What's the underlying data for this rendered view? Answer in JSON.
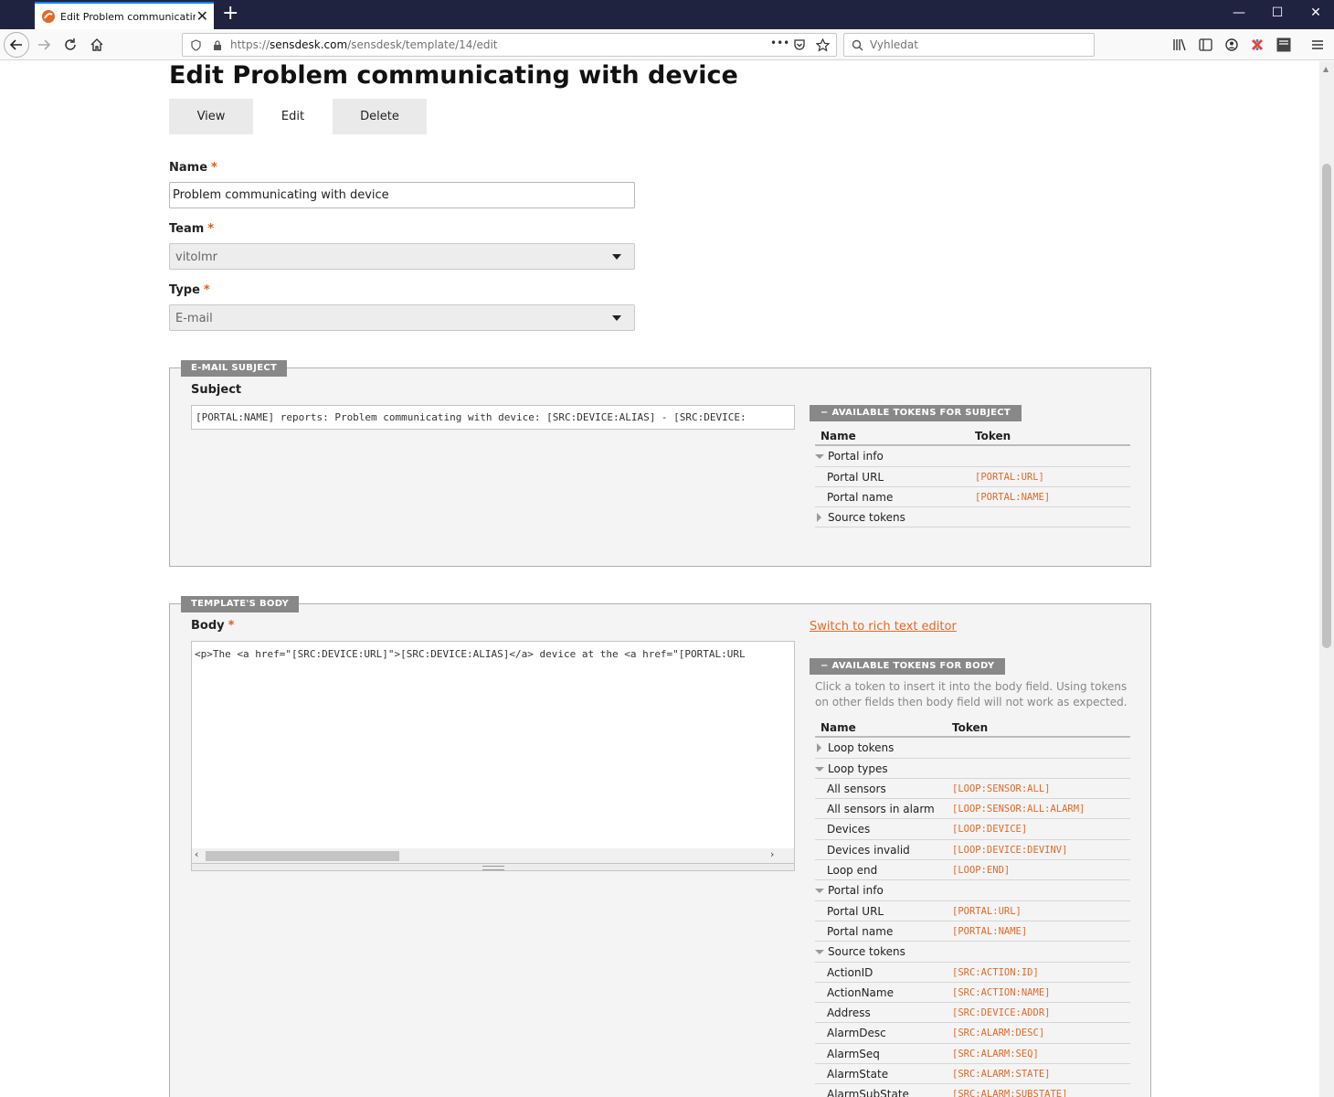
{
  "browser": {
    "tab_title": "Edit Problem communicating w",
    "tab_close": "✕",
    "new_tab": "+",
    "url_domain": "sensdesk.com",
    "url_prefix": "https://",
    "url_path": "/sensdesk/template/14/edit",
    "search_placeholder": "Vyhledat",
    "page_actions": "•••",
    "window_minimize": "—",
    "window_maximize": "☐",
    "window_close": "✕",
    "icons": [
      "back-icon",
      "forward-icon",
      "reload-icon",
      "home-icon",
      "shield-icon",
      "lock-icon",
      "pocket-icon",
      "star-icon",
      "search-icon",
      "library-icon",
      "sidebar-icon",
      "account-icon",
      "extension-icon",
      "menu-icon"
    ]
  },
  "page": {
    "title": "Edit Problem communicating with device",
    "tabs": [
      {
        "label": "View",
        "active": false
      },
      {
        "label": "Edit",
        "active": true
      },
      {
        "label": "Delete",
        "active": false
      }
    ]
  },
  "form": {
    "name_label": "Name",
    "name_value": "Problem communicating with device",
    "team_label": "Team",
    "team_value": "vitolmr",
    "type_label": "Type",
    "type_value": "E-mail",
    "required_mark": "*"
  },
  "subject_section": {
    "legend": "E-MAIL SUBJECT",
    "label": "Subject",
    "value": "[PORTAL:NAME] reports: Problem communicating with device: [SRC:DEVICE:ALIAS] - [SRC:DEVICE:",
    "tokens_header": "−  AVAILABLE TOKENS FOR SUBJECT",
    "col_name": "Name",
    "col_token": "Token",
    "rows": [
      {
        "kind": "group-open",
        "name": "Portal info",
        "token": ""
      },
      {
        "kind": "item",
        "name": "Portal URL",
        "token": "[PORTAL:URL]"
      },
      {
        "kind": "item",
        "name": "Portal name",
        "token": "[PORTAL:NAME]"
      },
      {
        "kind": "group-closed",
        "name": "Source tokens",
        "token": ""
      }
    ]
  },
  "body_section": {
    "legend": "TEMPLATE'S BODY",
    "label": "Body",
    "value": "<p>The <a href=\"[SRC:DEVICE:URL]\">[SRC:DEVICE:ALIAS]</a> device at the <a href=\"[PORTAL:URL",
    "switch_link": "Switch to rich text editor",
    "tokens_header": "−  AVAILABLE TOKENS FOR BODY",
    "help": "Click a token to insert it into the body field. Using tokens on other fields then body field will not work as expected.",
    "col_name": "Name",
    "col_token": "Token",
    "rows": [
      {
        "kind": "group-closed",
        "name": "Loop tokens",
        "token": ""
      },
      {
        "kind": "group-open",
        "name": "Loop types",
        "token": ""
      },
      {
        "kind": "item",
        "name": "All sensors",
        "token": "[LOOP:SENSOR:ALL]"
      },
      {
        "kind": "item",
        "name": "All sensors in alarm",
        "token": "[LOOP:SENSOR:ALL:ALARM]"
      },
      {
        "kind": "item",
        "name": "Devices",
        "token": "[LOOP:DEVICE]"
      },
      {
        "kind": "item",
        "name": "Devices invalid",
        "token": "[LOOP:DEVICE:DEVINV]"
      },
      {
        "kind": "item",
        "name": "Loop end",
        "token": "[LOOP:END]"
      },
      {
        "kind": "group-open",
        "name": "Portal info",
        "token": ""
      },
      {
        "kind": "item",
        "name": "Portal URL",
        "token": "[PORTAL:URL]"
      },
      {
        "kind": "item",
        "name": "Portal name",
        "token": "[PORTAL:NAME]"
      },
      {
        "kind": "group-open",
        "name": "Source tokens",
        "token": ""
      },
      {
        "kind": "item",
        "name": "ActionID",
        "token": "[SRC:ACTION:ID]"
      },
      {
        "kind": "item",
        "name": "ActionName",
        "token": "[SRC:ACTION:NAME]"
      },
      {
        "kind": "item",
        "name": "Address",
        "token": "[SRC:DEVICE:ADDR]"
      },
      {
        "kind": "item",
        "name": "AlarmDesc",
        "token": "[SRC:ALARM:DESC]"
      },
      {
        "kind": "item",
        "name": "AlarmSeq",
        "token": "[SRC:ALARM:SEQ]"
      },
      {
        "kind": "item",
        "name": "AlarmState",
        "token": "[SRC:ALARM:STATE]"
      },
      {
        "kind": "item",
        "name": "AlarmSubState",
        "token": "[SRC:ALARM:SUBSTATE]"
      }
    ]
  },
  "colors": {
    "accent": "#e06a2a",
    "titlebar": "#202340",
    "legend_bg": "#888888"
  }
}
